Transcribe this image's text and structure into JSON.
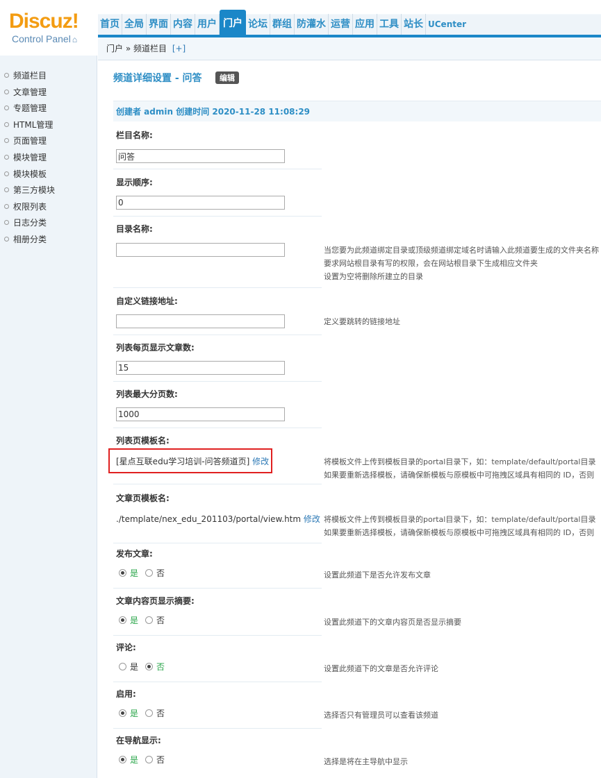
{
  "logo": {
    "brand": "Discuz",
    "excl": "!",
    "sub": "Control Panel",
    "home_icon": "home-icon"
  },
  "topnav": {
    "items": [
      "首页",
      "全局",
      "界面",
      "内容",
      "用户",
      "门户",
      "论坛",
      "群组",
      "防灌水",
      "运营",
      "应用",
      "工具",
      "站长",
      "UCenter"
    ],
    "active_index": 5
  },
  "breadcrumb": {
    "path": "门户 » 频道栏目",
    "plus": "[+]"
  },
  "sidebar": {
    "items": [
      "频道栏目",
      "文章管理",
      "专题管理",
      "HTML管理",
      "页面管理",
      "模块管理",
      "模块模板",
      "第三方模块",
      "权限列表",
      "日志分类",
      "相册分类"
    ]
  },
  "page": {
    "title": "频道详细设置 - 问答",
    "edit_label": "编辑"
  },
  "creator": "创建者 admin 创建时间 2020-11-28 11:08:29",
  "form": {
    "name": {
      "label": "栏目名称:",
      "value": "问答"
    },
    "order": {
      "label": "显示顺序:",
      "value": "0"
    },
    "dir": {
      "label": "目录名称:",
      "value": "",
      "tip1": "当您要为此频道绑定目录或顶级频道绑定域名时请输入此频道要生成的文件夹名称",
      "tip2": "要求网站根目录有写的权限，会在网站根目录下生成相应文件夹",
      "tip3": "设置为空将删除所建立的目录"
    },
    "link": {
      "label": "自定义链接地址:",
      "value": "",
      "tip": "定义要跳转的链接地址"
    },
    "perpage": {
      "label": "列表每页显示文章数:",
      "value": "15"
    },
    "maxpage": {
      "label": "列表最大分页数:",
      "value": "1000"
    },
    "list_tpl": {
      "label": "列表页模板名:",
      "value": "[星点互联edu学习培训-问答频道页]",
      "edit": "修改",
      "tip1": "将模板文件上传到模板目录的portal目录下，如：template/default/portal目录",
      "tip2": "如果要重新选择模板，请确保新模板与原模板中可拖拽区域具有相同的 ID，否则"
    },
    "view_tpl": {
      "label": "文章页模板名:",
      "value": "./template/nex_edu_201103/portal/view.htm",
      "edit": "修改",
      "tip1": "将模板文件上传到模板目录的portal目录下，如：template/default/portal目录",
      "tip2": "如果要重新选择模板，请确保新模板与原模板中可拖拽区域具有相同的 ID，否则"
    },
    "yes": "是",
    "no": "否",
    "allow_publish": {
      "label": "发布文章:",
      "checked": "yes",
      "tip": "设置此频道下是否允许发布文章"
    },
    "show_summary": {
      "label": "文章内容页显示摘要:",
      "checked": "yes",
      "tip": "设置此频道下的文章内容页是否显示摘要"
    },
    "comment": {
      "label": "评论:",
      "checked": "no",
      "tip": "设置此频道下的文章是否允许评论"
    },
    "enable": {
      "label": "启用:",
      "checked": "yes",
      "tip": "选择否只有管理员可以查看该频道"
    },
    "nav_show": {
      "label": "在导航显示:",
      "checked": "yes",
      "tip": "选择是将在主导航中显示"
    }
  }
}
